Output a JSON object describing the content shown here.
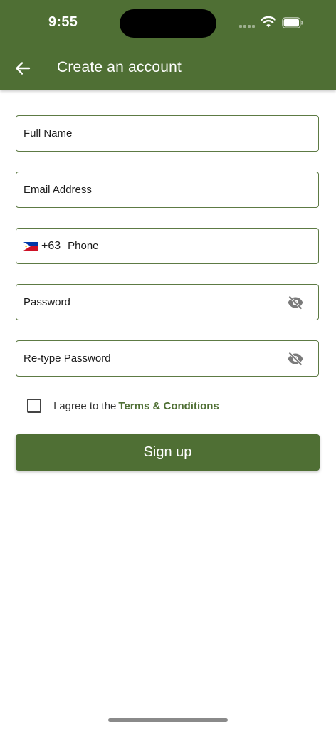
{
  "status_bar": {
    "time": "9:55"
  },
  "header": {
    "title": "Create an account",
    "back_icon": "arrow-left-icon"
  },
  "form": {
    "full_name": {
      "placeholder": "Full Name",
      "value": ""
    },
    "email": {
      "placeholder": "Email Address",
      "value": ""
    },
    "phone": {
      "country": "Philippines",
      "dial_code": "+63",
      "placeholder": "Phone",
      "value": ""
    },
    "password": {
      "placeholder": "Password",
      "value": "",
      "toggle_icon": "eye-off-icon"
    },
    "retype_password": {
      "placeholder": "Re-type Password",
      "value": "",
      "toggle_icon": "eye-off-icon"
    }
  },
  "agreement": {
    "checked": false,
    "text": "I agree to the",
    "link": "Terms & Conditions"
  },
  "signup_button": {
    "label": "Sign up"
  },
  "colors": {
    "primary": "#4f6f34",
    "field_border": "#5d7a44",
    "background": "#ffffff"
  }
}
